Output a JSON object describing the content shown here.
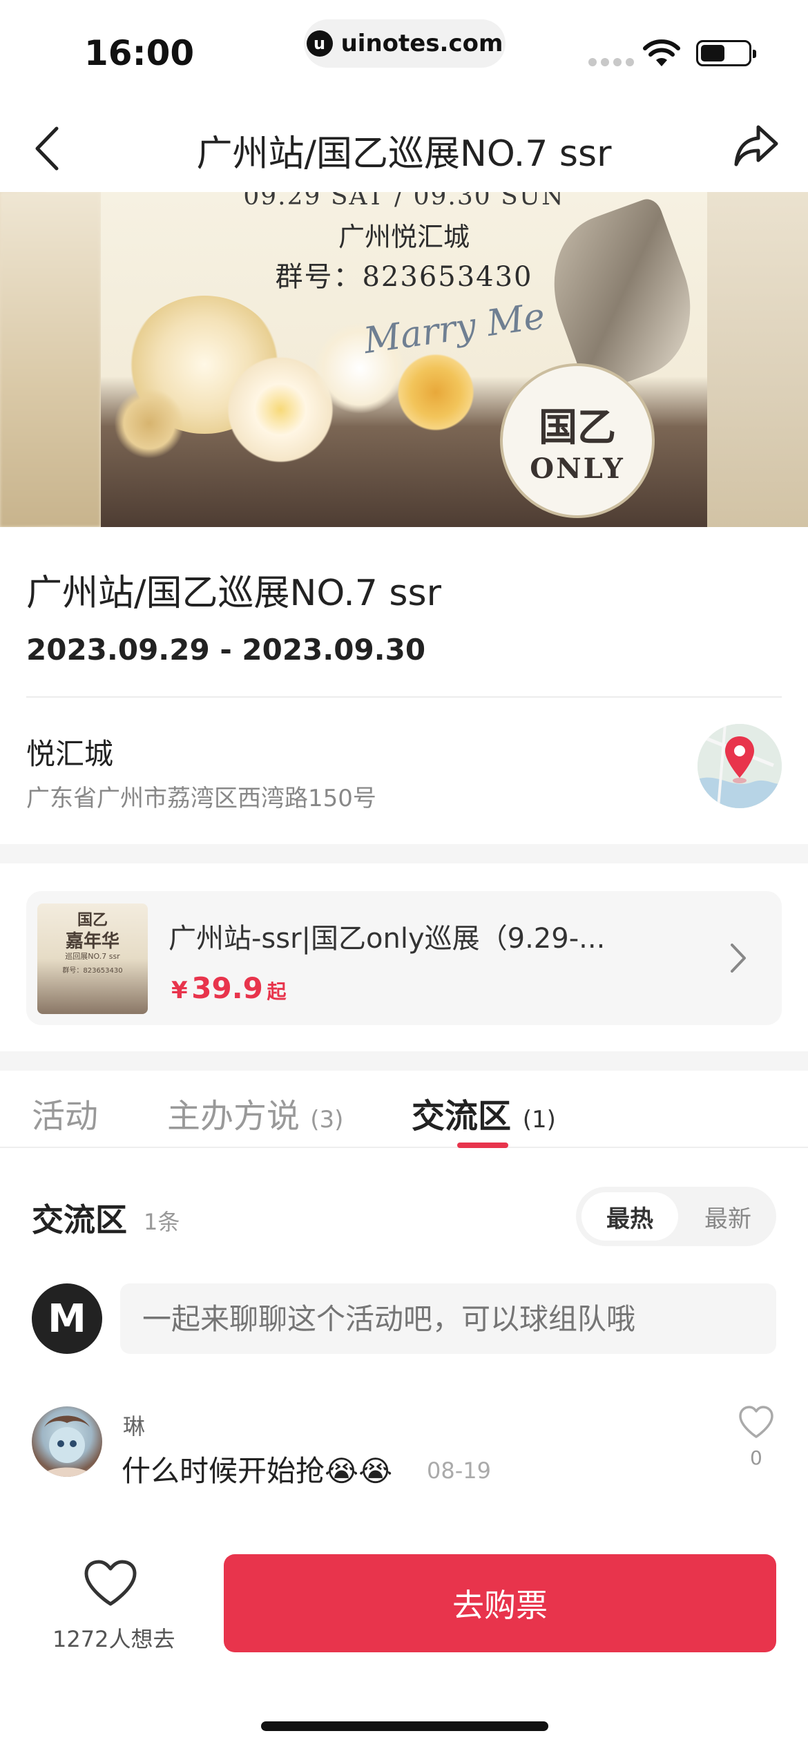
{
  "status_bar": {
    "time": "16:00",
    "url": "uinotes.com"
  },
  "nav": {
    "title": "广州站/国乙巡展NO.7 ssr"
  },
  "banner": {
    "line1": "09.29 SAT / 09.30 SUN",
    "line2": "广州悦汇城",
    "line3": "群号：823653430",
    "script_text": "Marry Me",
    "seal_main": "国乙",
    "seal_sub": "ONLY"
  },
  "event": {
    "title": "广州站/国乙巡展NO.7 ssr",
    "date": "2023.09.29 - 2023.09.30",
    "venue": "悦汇城",
    "address": "广东省广州市荔湾区西湾路150号"
  },
  "ticket": {
    "thumb_line1": "国乙",
    "thumb_line2": "嘉年华",
    "thumb_line3": "巡回展NO.7 ssr",
    "thumb_line4": "群号：823653430",
    "name": "广州站-ssr|国乙only巡展（9.29-...",
    "currency": "¥",
    "price": "39.9",
    "price_suffix": "起"
  },
  "tabs": [
    {
      "label": "活动",
      "count": ""
    },
    {
      "label": "主办方说",
      "count": "(3)"
    },
    {
      "label": "交流区",
      "count": "(1)"
    }
  ],
  "comments": {
    "heading": "交流区",
    "count": "1条",
    "sort_hot": "最热",
    "sort_new": "最新",
    "input_placeholder": "一起来聊聊这个活动吧，可以球组队哦",
    "my_avatar_letter": "M",
    "items": [
      {
        "user": "琳",
        "text": "什么时候开始抢😭😭",
        "date": "08-19",
        "likes": "0"
      }
    ]
  },
  "bottom": {
    "want_count": "1272人想去",
    "buy_label": "去购票"
  },
  "colors": {
    "accent": "#e8344c",
    "muted": "#999999"
  }
}
